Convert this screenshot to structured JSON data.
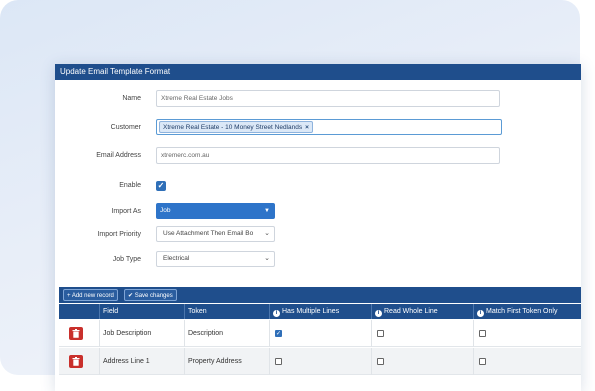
{
  "dialog": {
    "title": "Update Email Template Format"
  },
  "form": {
    "name": {
      "label": "Name",
      "value": "Xtreme Real Estate Jobs"
    },
    "customer": {
      "label": "Customer",
      "tag": "Xtreme Real Estate - 10 Money Street Nedlands",
      "remove": "×"
    },
    "email": {
      "label": "Email Address",
      "value": "xtremerc.com.au"
    },
    "enable": {
      "label": "Enable",
      "checked": true,
      "mark": "✓"
    },
    "import_as": {
      "label": "Import As",
      "value": "Job",
      "caret": "▼"
    },
    "import_priority": {
      "label": "Import Priority",
      "value": "Use Attachment Then Email Bo",
      "caret": "⌄"
    },
    "job_type": {
      "label": "Job Type",
      "value": "Electrical",
      "caret": "⌄"
    }
  },
  "toolbar": {
    "add_label": "+ Add new record",
    "save_label": "✔ Save changes"
  },
  "grid": {
    "columns": [
      "",
      "Field",
      "Token",
      "Has Multiple Lines",
      "Read Whole Line",
      "Match First Token Only"
    ],
    "info_icon": "i",
    "rows": [
      {
        "field": "Job Description",
        "token": "Description",
        "multi": true,
        "whole": false,
        "first": false
      },
      {
        "field": "Address Line 1",
        "token": "Property Address",
        "multi": false,
        "whole": false,
        "first": false
      }
    ],
    "check_mark": "✓"
  },
  "colors": {
    "header": "#1f4e8c",
    "accent": "#2e74c9",
    "delete": "#c9302c"
  }
}
